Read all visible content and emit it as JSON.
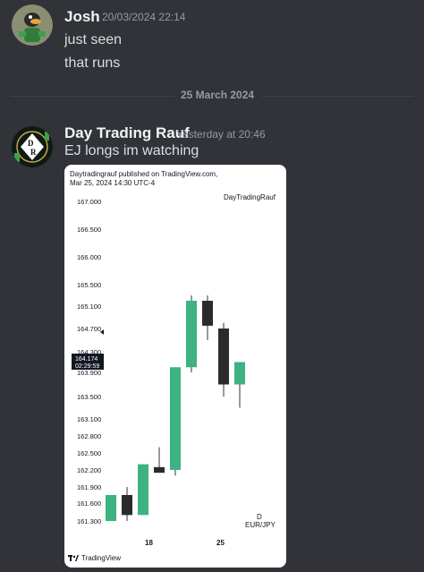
{
  "messages": [
    {
      "username": "Josh",
      "timestamp": "20/03/2024 22:14",
      "lines": [
        "just seen",
        "that runs"
      ],
      "avatar_icon": "duck-avatar-icon"
    },
    {
      "username": "Day Trading Rauf",
      "timestamp": "Yesterday at 20:46",
      "lines": [
        "EJ longs im watching"
      ],
      "avatar_icon": "dr-logo-avatar-icon"
    }
  ],
  "divider": {
    "label": "25 March 2024"
  },
  "attachment": {
    "header_line1": "Daytradingrauf published on TradingView.com,",
    "header_line2": "Mar 25, 2024 14:30 UTC-4",
    "author": "DayTradingRauf",
    "brand": "TradingView",
    "timeframe": "D",
    "symbol": "EUR/JPY",
    "price_marker": {
      "price": "164.174",
      "countdown": "02:29:59"
    }
  },
  "chart_data": {
    "type": "candlestick",
    "y_ticks": [
      "167.000",
      "166.500",
      "166.000",
      "165.500",
      "165.100",
      "164.700",
      "164.300",
      "163.900",
      "163.500",
      "163.100",
      "162.800",
      "162.500",
      "162.200",
      "161.900",
      "161.600",
      "161.300"
    ],
    "x_ticks": [
      "18",
      "25"
    ],
    "candles": [
      {
        "open": 161.3,
        "high": 161.75,
        "low": 161.3,
        "close": 161.75,
        "dir": "up"
      },
      {
        "open": 161.75,
        "high": 161.9,
        "low": 161.25,
        "close": 161.4,
        "dir": "down"
      },
      {
        "open": 161.4,
        "high": 162.3,
        "low": 161.4,
        "close": 162.3,
        "dir": "up"
      },
      {
        "open": 162.25,
        "high": 162.6,
        "low": 162.2,
        "close": 162.15,
        "dir": "down"
      },
      {
        "open": 162.2,
        "high": 164.0,
        "low": 162.1,
        "close": 164.0,
        "dir": "up"
      },
      {
        "open": 164.0,
        "high": 165.3,
        "low": 163.9,
        "close": 165.2,
        "dir": "up"
      },
      {
        "open": 165.2,
        "high": 165.3,
        "low": 164.5,
        "close": 164.75,
        "dir": "down"
      },
      {
        "open": 164.7,
        "high": 164.8,
        "low": 163.5,
        "close": 163.7,
        "dir": "down"
      },
      {
        "open": 163.7,
        "high": 164.1,
        "low": 163.3,
        "close": 164.1,
        "dir": "up"
      }
    ],
    "colors": {
      "up": "#3db37f",
      "down": "#2b2b2b"
    }
  }
}
